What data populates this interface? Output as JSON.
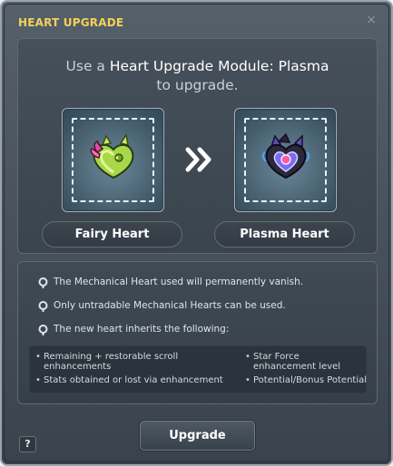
{
  "window": {
    "title": "HEART UPGRADE",
    "close_symbol": "×"
  },
  "message": {
    "line1_prefix": "Use a ",
    "line1_item": "Heart Upgrade Module: Plasma",
    "line2": "to upgrade."
  },
  "slots": {
    "source": {
      "name": "Fairy Heart",
      "icon": "fairy-heart-icon"
    },
    "target": {
      "name": "Plasma Heart",
      "icon": "plasma-heart-icon"
    },
    "arrow_icon": "double-chevron-right-icon"
  },
  "rules": [
    {
      "icon": "pin-icon",
      "text": "The Mechanical Heart used will permanently vanish."
    },
    {
      "icon": "pin-icon",
      "text": "Only untradable Mechanical Hearts can be used."
    },
    {
      "icon": "pin-icon",
      "text": "The new heart inherits the following:"
    }
  ],
  "inherits": [
    {
      "bullet": "•",
      "text": "Remaining + restorable scroll enhancements"
    },
    {
      "bullet": "•",
      "text": "Stats obtained or lost via enhancement"
    },
    {
      "bullet": "•",
      "text": "Star Force enhancement level"
    },
    {
      "bullet": "•",
      "text": "Potential/Bonus Potential"
    }
  ],
  "buttons": {
    "upgrade": "Upgrade",
    "help": "?"
  },
  "colors": {
    "title": "#f3d15a",
    "panel": "#3f4952",
    "slot_glow": "#6b8899"
  }
}
